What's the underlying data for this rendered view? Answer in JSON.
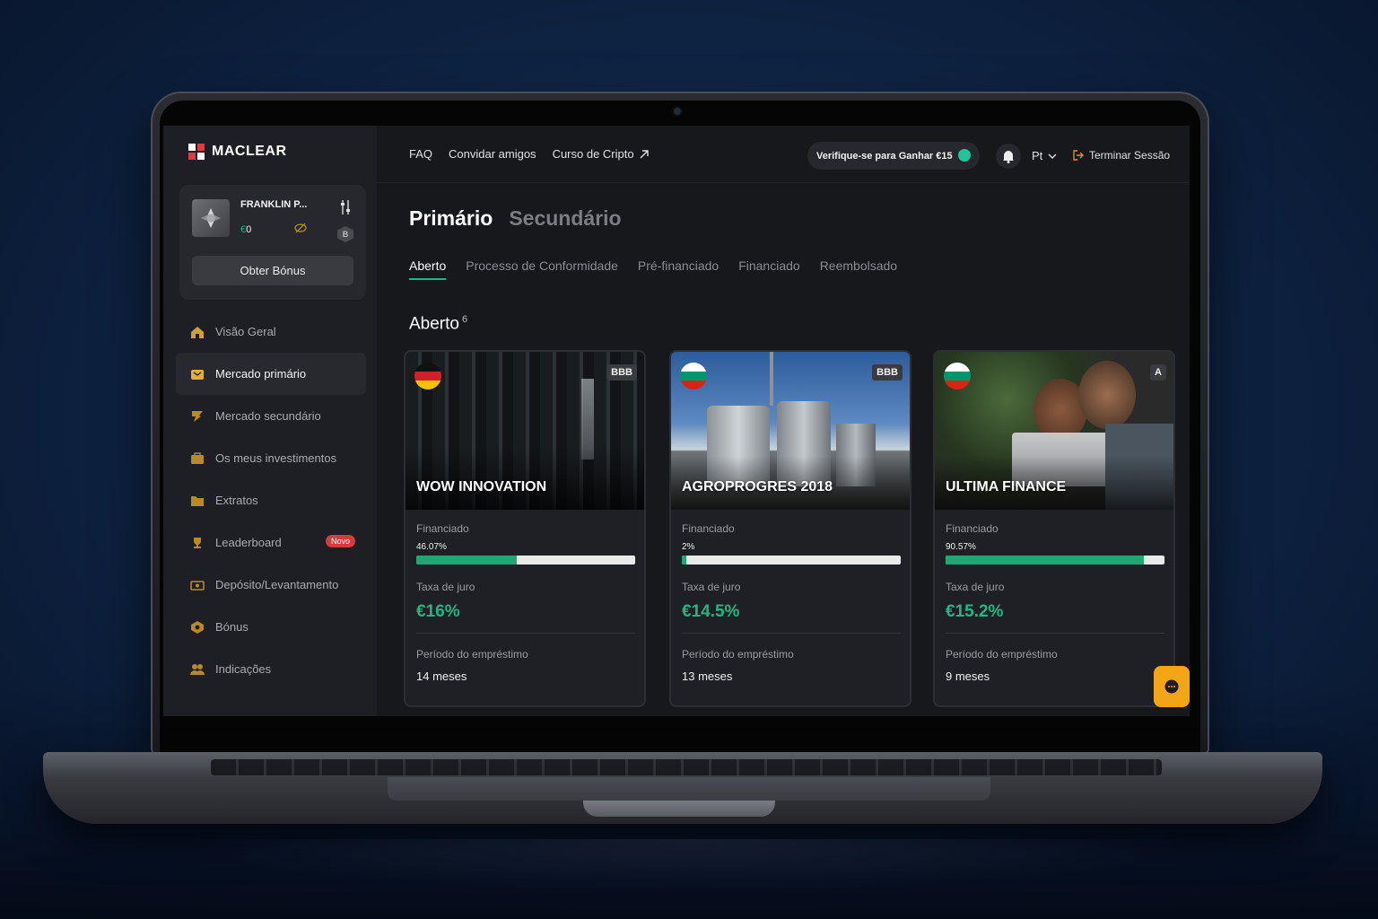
{
  "app": {
    "brand": "MACLEAR"
  },
  "topbar": {
    "links": [
      "FAQ",
      "Convidar amigos",
      "Curso de Cripto"
    ],
    "verify": "Verifique-se para Ganhar €15",
    "lang": "Pt",
    "logout": "Terminar Sessão"
  },
  "user": {
    "name": "FRANKLIN P...",
    "currency": "€",
    "balance": "0",
    "level": "B",
    "bonus_button": "Obter Bónus"
  },
  "sidebar": {
    "items": [
      {
        "label": "Visão Geral",
        "icon": "home-icon"
      },
      {
        "label": "Mercado primário",
        "icon": "wallet-icon"
      },
      {
        "label": "Mercado secundário",
        "icon": "flag-icon"
      },
      {
        "label": "Os meus investimentos",
        "icon": "briefcase-icon"
      },
      {
        "label": "Extratos",
        "icon": "folder-icon"
      },
      {
        "label": "Leaderboard",
        "icon": "trophy-icon",
        "badge": "Novo"
      },
      {
        "label": "Depósito/Levantamento",
        "icon": "cash-icon"
      },
      {
        "label": "Bónus",
        "icon": "bonus-icon"
      },
      {
        "label": "Indicações",
        "icon": "users-icon"
      }
    ]
  },
  "main": {
    "tabs": [
      "Primário",
      "Secundário"
    ],
    "subtabs": [
      "Aberto",
      "Processo de Conformidade",
      "Pré-financiado",
      "Financiado",
      "Reembolsado"
    ],
    "section_title": "Aberto",
    "section_count": "6",
    "labels": {
      "funded": "Financiado",
      "rate": "Taxa de juro",
      "period": "Período do empréstimo"
    },
    "cards": [
      {
        "name": "WOW INNOVATION",
        "rating": "BBB",
        "country": "germany",
        "funded_pct": 46.07,
        "funded_text": "46.07%",
        "rate": "€16%",
        "months": "14 meses"
      },
      {
        "name": "AGROPROGRES 2018",
        "rating": "BBB",
        "country": "bulgaria",
        "funded_pct": 2,
        "funded_text": "2%",
        "rate": "€14.5%",
        "months": "13 meses"
      },
      {
        "name": "ULTIMA FINANCE",
        "rating": "A",
        "country": "bulgaria",
        "funded_pct": 90.57,
        "funded_text": "90.57%",
        "rate": "€15.2%",
        "months": "9 meses"
      }
    ]
  },
  "colors": {
    "accent": "#1fb884",
    "icon": "#d2a02f",
    "chat": "#f3a516"
  }
}
